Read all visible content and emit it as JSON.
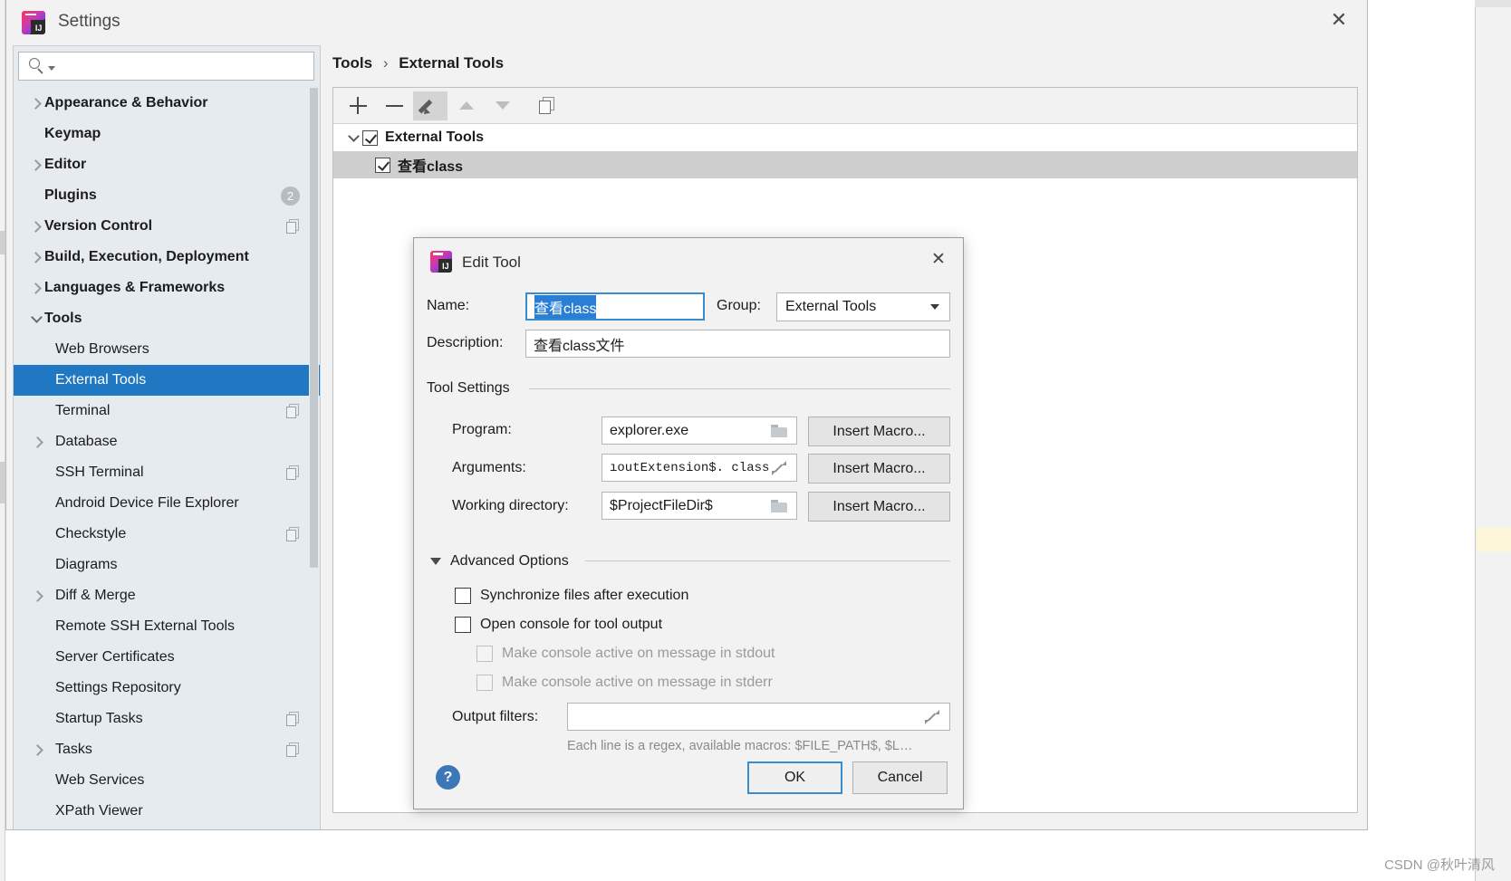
{
  "window": {
    "title": "Settings",
    "close_label": "✕",
    "app_icon": "intellij-idea-icon"
  },
  "search": {
    "placeholder": "",
    "value": "",
    "icon": "search-icon"
  },
  "sidebar": {
    "items": [
      {
        "label": "Appearance & Behavior",
        "level": 1,
        "arrow": "collapsed",
        "bold": true
      },
      {
        "label": "Keymap",
        "level": 1,
        "arrow": "none",
        "bold": true
      },
      {
        "label": "Editor",
        "level": 1,
        "arrow": "collapsed",
        "bold": true
      },
      {
        "label": "Plugins",
        "level": 1,
        "arrow": "none",
        "bold": true,
        "badge": "2"
      },
      {
        "label": "Version Control",
        "level": 1,
        "arrow": "collapsed",
        "bold": true,
        "copy_icon": true
      },
      {
        "label": "Build, Execution, Deployment",
        "level": 1,
        "arrow": "collapsed",
        "bold": true
      },
      {
        "label": "Languages & Frameworks",
        "level": 1,
        "arrow": "collapsed",
        "bold": true
      },
      {
        "label": "Tools",
        "level": 1,
        "arrow": "expanded",
        "bold": true
      },
      {
        "label": "Web Browsers",
        "level": 2,
        "arrow": "none",
        "bold": false
      },
      {
        "label": "External Tools",
        "level": 2,
        "arrow": "none",
        "bold": false,
        "selected": true
      },
      {
        "label": "Terminal",
        "level": 2,
        "arrow": "none",
        "bold": false,
        "copy_icon": true
      },
      {
        "label": "Database",
        "level": 2,
        "arrow": "collapsed",
        "bold": false
      },
      {
        "label": "SSH Terminal",
        "level": 2,
        "arrow": "none",
        "bold": false,
        "copy_icon": true
      },
      {
        "label": "Android Device File Explorer",
        "level": 2,
        "arrow": "none",
        "bold": false
      },
      {
        "label": "Checkstyle",
        "level": 2,
        "arrow": "none",
        "bold": false,
        "copy_icon": true
      },
      {
        "label": "Diagrams",
        "level": 2,
        "arrow": "none",
        "bold": false
      },
      {
        "label": "Diff & Merge",
        "level": 2,
        "arrow": "collapsed",
        "bold": false
      },
      {
        "label": "Remote SSH External Tools",
        "level": 2,
        "arrow": "none",
        "bold": false
      },
      {
        "label": "Server Certificates",
        "level": 2,
        "arrow": "none",
        "bold": false
      },
      {
        "label": "Settings Repository",
        "level": 2,
        "arrow": "none",
        "bold": false
      },
      {
        "label": "Startup Tasks",
        "level": 2,
        "arrow": "none",
        "bold": false,
        "copy_icon": true
      },
      {
        "label": "Tasks",
        "level": 2,
        "arrow": "collapsed",
        "bold": false,
        "copy_icon": true
      },
      {
        "label": "Web Services",
        "level": 2,
        "arrow": "none",
        "bold": false
      },
      {
        "label": "XPath Viewer",
        "level": 2,
        "arrow": "none",
        "bold": false
      }
    ]
  },
  "main": {
    "breadcrumb": {
      "root": "Tools",
      "separator": "›",
      "leaf": "External Tools"
    },
    "toolbar": [
      {
        "name": "add-button",
        "icon": "plus-icon",
        "enabled": true
      },
      {
        "name": "remove-button",
        "icon": "minus-icon",
        "enabled": true
      },
      {
        "name": "edit-button",
        "icon": "pencil-icon",
        "enabled": true,
        "active": true
      },
      {
        "name": "move-up-button",
        "icon": "arrow-up-icon",
        "enabled": false
      },
      {
        "name": "move-down-button",
        "icon": "arrow-down-icon",
        "enabled": false
      },
      {
        "name": "copy-button",
        "icon": "copy-icon",
        "enabled": true
      }
    ],
    "tree": {
      "group": {
        "label": "External Tools",
        "checked": true,
        "expanded": true
      },
      "children": [
        {
          "label": "查看class",
          "checked": true,
          "selected": true
        }
      ]
    }
  },
  "dialog": {
    "title": "Edit Tool",
    "icon": "intellij-idea-icon",
    "close_label": "✕",
    "name": {
      "label": "Name:",
      "value": "查看class",
      "selected": true
    },
    "group": {
      "label": "Group:",
      "value": "External Tools",
      "options": [
        "External Tools"
      ]
    },
    "description": {
      "label": "Description:",
      "value": "查看class文件"
    },
    "tool_settings": {
      "section_label": "Tool Settings",
      "program": {
        "label": "Program:",
        "value": "explorer.exe",
        "macro_button": "Insert Macro..."
      },
      "arguments": {
        "label": "Arguments:",
        "value": "ıoutExtension$. class”",
        "macro_button": "Insert Macro..."
      },
      "working_directory": {
        "label": "Working directory:",
        "value": "$ProjectFileDir$",
        "macro_button": "Insert Macro..."
      }
    },
    "advanced": {
      "section_label": "Advanced Options",
      "expanded": true,
      "checkboxes": [
        {
          "label": "Synchronize files after execution",
          "checked": false,
          "disabled": false,
          "indent": 0
        },
        {
          "label": "Open console for tool output",
          "checked": false,
          "disabled": false,
          "indent": 0
        },
        {
          "label": "Make console active on message in stdout",
          "checked": false,
          "disabled": true,
          "indent": 1
        },
        {
          "label": "Make console active on message in stderr",
          "checked": false,
          "disabled": true,
          "indent": 1
        }
      ],
      "output_filters": {
        "label": "Output filters:",
        "value": ""
      },
      "hint": "Each line is a regex, available macros: $FILE_PATH$, $L…"
    },
    "footer": {
      "help_label": "?",
      "ok_label": "OK",
      "cancel_label": "Cancel"
    }
  },
  "watermark": "CSDN @秋叶清风"
}
